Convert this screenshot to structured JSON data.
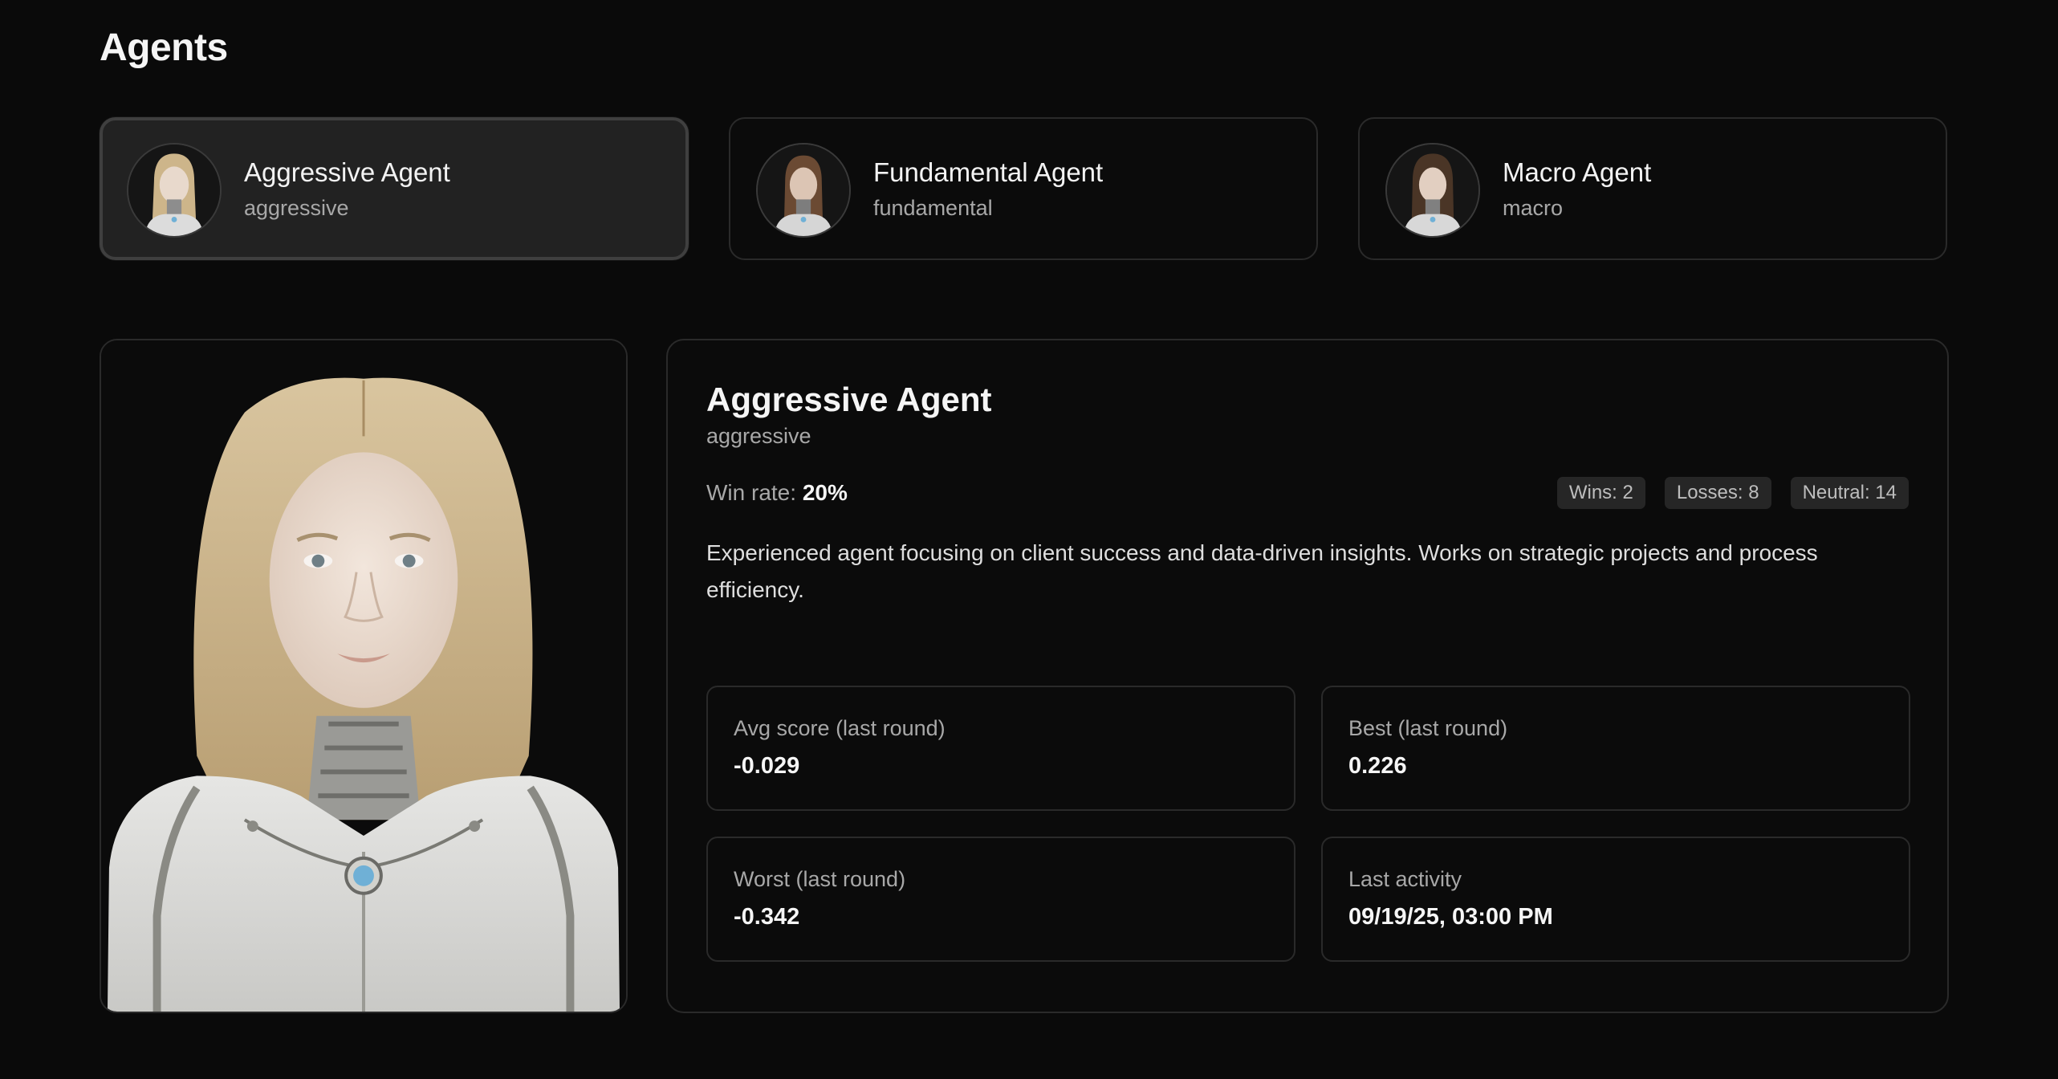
{
  "page": {
    "title": "Agents"
  },
  "agents": [
    {
      "name": "Aggressive Agent",
      "slug": "aggressive",
      "active": true,
      "avatar_icon": "robot-woman-avatar"
    },
    {
      "name": "Fundamental Agent",
      "slug": "fundamental",
      "active": false,
      "avatar_icon": "robot-woman-avatar"
    },
    {
      "name": "Macro Agent",
      "slug": "macro",
      "active": false,
      "avatar_icon": "robot-woman-avatar"
    }
  ],
  "detail": {
    "name": "Aggressive Agent",
    "slug": "aggressive",
    "win_rate_label": "Win rate:",
    "win_rate_value": "20%",
    "badges": {
      "wins": "Wins: 2",
      "losses": "Losses: 8",
      "neutral": "Neutral: 14"
    },
    "description": "Experienced agent focusing on client success and data-driven insights. Works on strategic projects and process efficiency.",
    "stats": [
      {
        "label": "Avg score (last round)",
        "value": "-0.029"
      },
      {
        "label": "Best (last round)",
        "value": "0.226"
      },
      {
        "label": "Worst (last round)",
        "value": "-0.342"
      },
      {
        "label": "Last activity",
        "value": "09/19/25, 03:00 PM"
      }
    ]
  },
  "colors": {
    "background": "#0a0a0a",
    "card_border": "#2a2a2a",
    "active_card_bg": "#222222",
    "text_primary": "#f5f5f5",
    "text_secondary": "#a8a8a8",
    "badge_bg": "#262626"
  }
}
